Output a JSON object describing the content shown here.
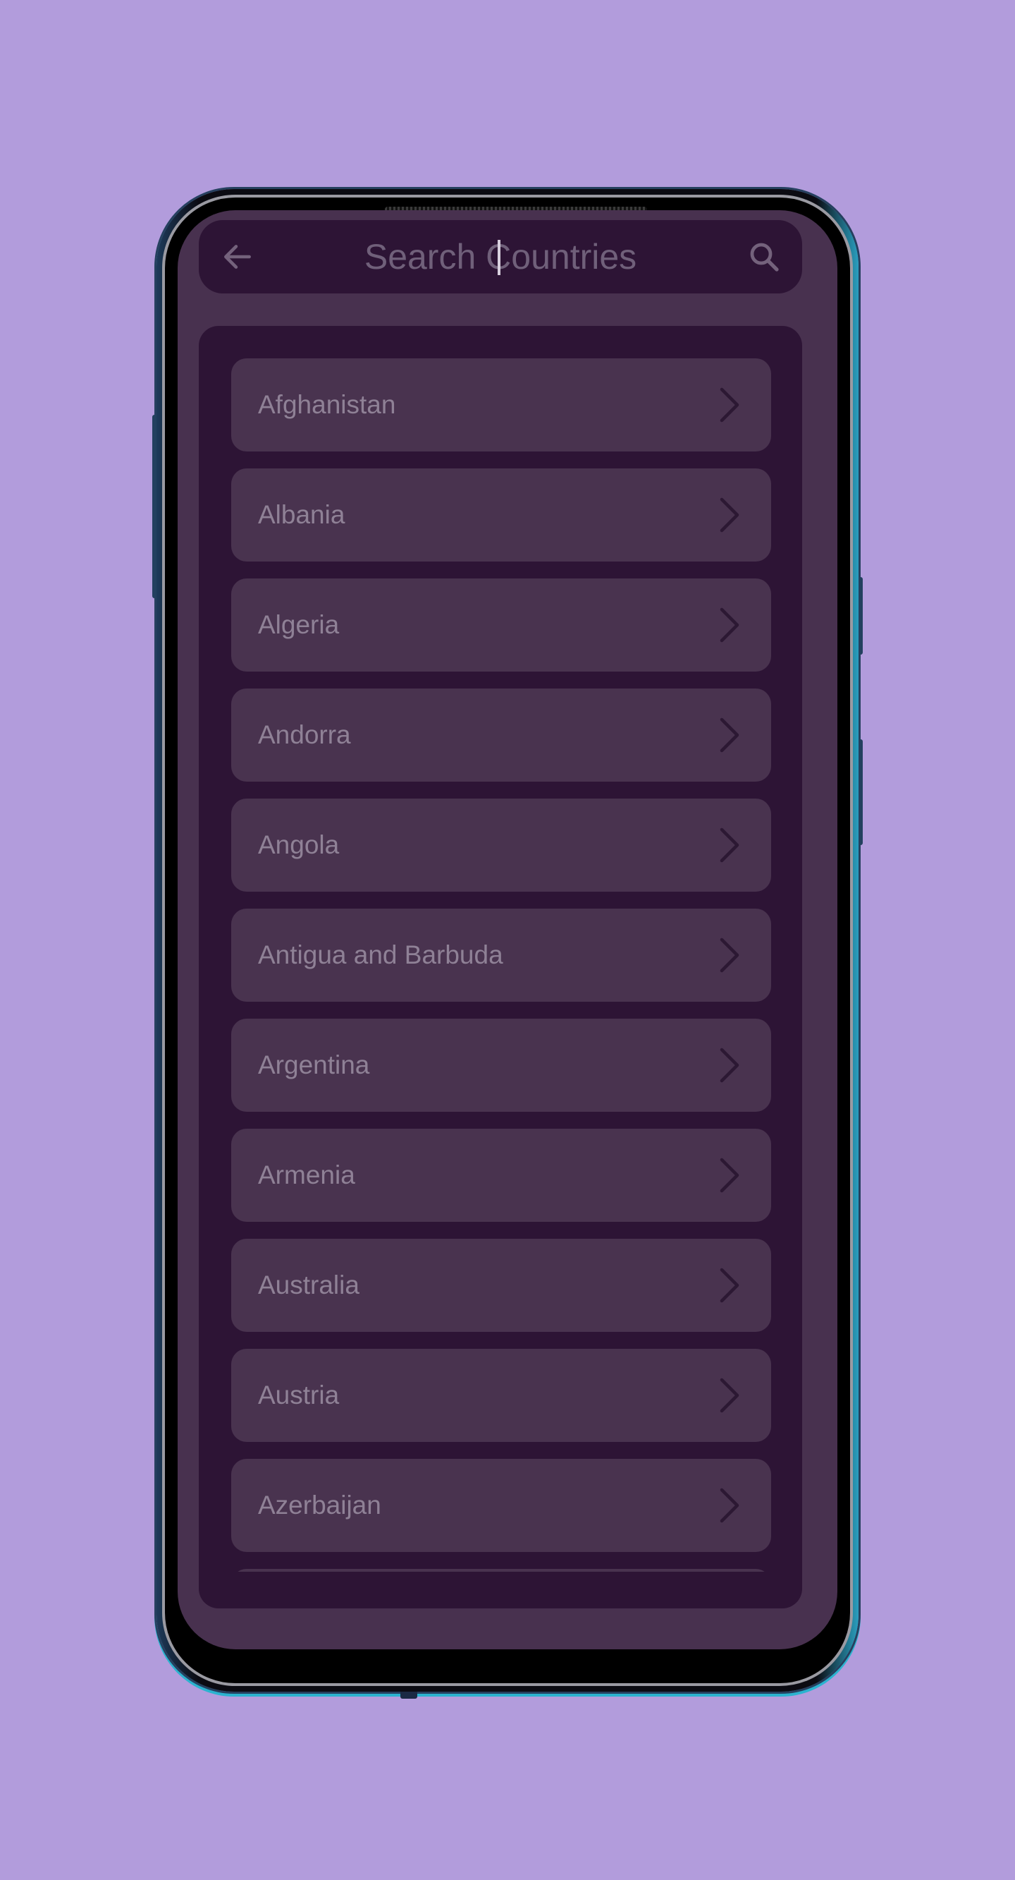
{
  "search": {
    "placeholder": "Search Countries",
    "back_icon": "arrow-left-icon",
    "search_icon": "magnifier-icon"
  },
  "countries": [
    {
      "label": "Afghanistan"
    },
    {
      "label": "Albania"
    },
    {
      "label": "Algeria"
    },
    {
      "label": "Andorra"
    },
    {
      "label": "Angola"
    },
    {
      "label": "Antigua and Barbuda"
    },
    {
      "label": "Argentina"
    },
    {
      "label": "Armenia"
    },
    {
      "label": "Australia"
    },
    {
      "label": "Austria"
    },
    {
      "label": "Azerbaijan"
    },
    {
      "label": ""
    }
  ],
  "colors": {
    "background": "#b29cdc",
    "screen": "#48314f",
    "panel": "#2d1435",
    "item": "#49334f",
    "text": "#8f8196"
  }
}
